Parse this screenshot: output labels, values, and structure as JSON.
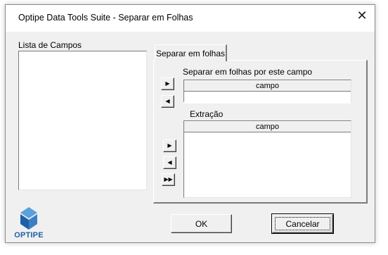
{
  "window": {
    "title": "Optipe Data Tools Suite - Separar em Folhas",
    "close_glyph": "✕"
  },
  "fields_list": {
    "label": "Lista de Campos",
    "items": []
  },
  "tab": {
    "label": "Separar em folhas"
  },
  "split_section": {
    "label": "Separar em folhas por este campo",
    "column_header": "campo",
    "rows": [
      ""
    ]
  },
  "extraction_section": {
    "label": "Extração",
    "column_header": "campo",
    "rows": []
  },
  "arrows": {
    "add": "▶",
    "remove": "◀",
    "add_all": "▶▶"
  },
  "buttons": {
    "ok": "OK",
    "cancel": "Cancelar"
  },
  "logo": {
    "text": "OPTIPE",
    "colors": {
      "dark": "#1f5fa8",
      "light": "#5aa0dc"
    }
  }
}
